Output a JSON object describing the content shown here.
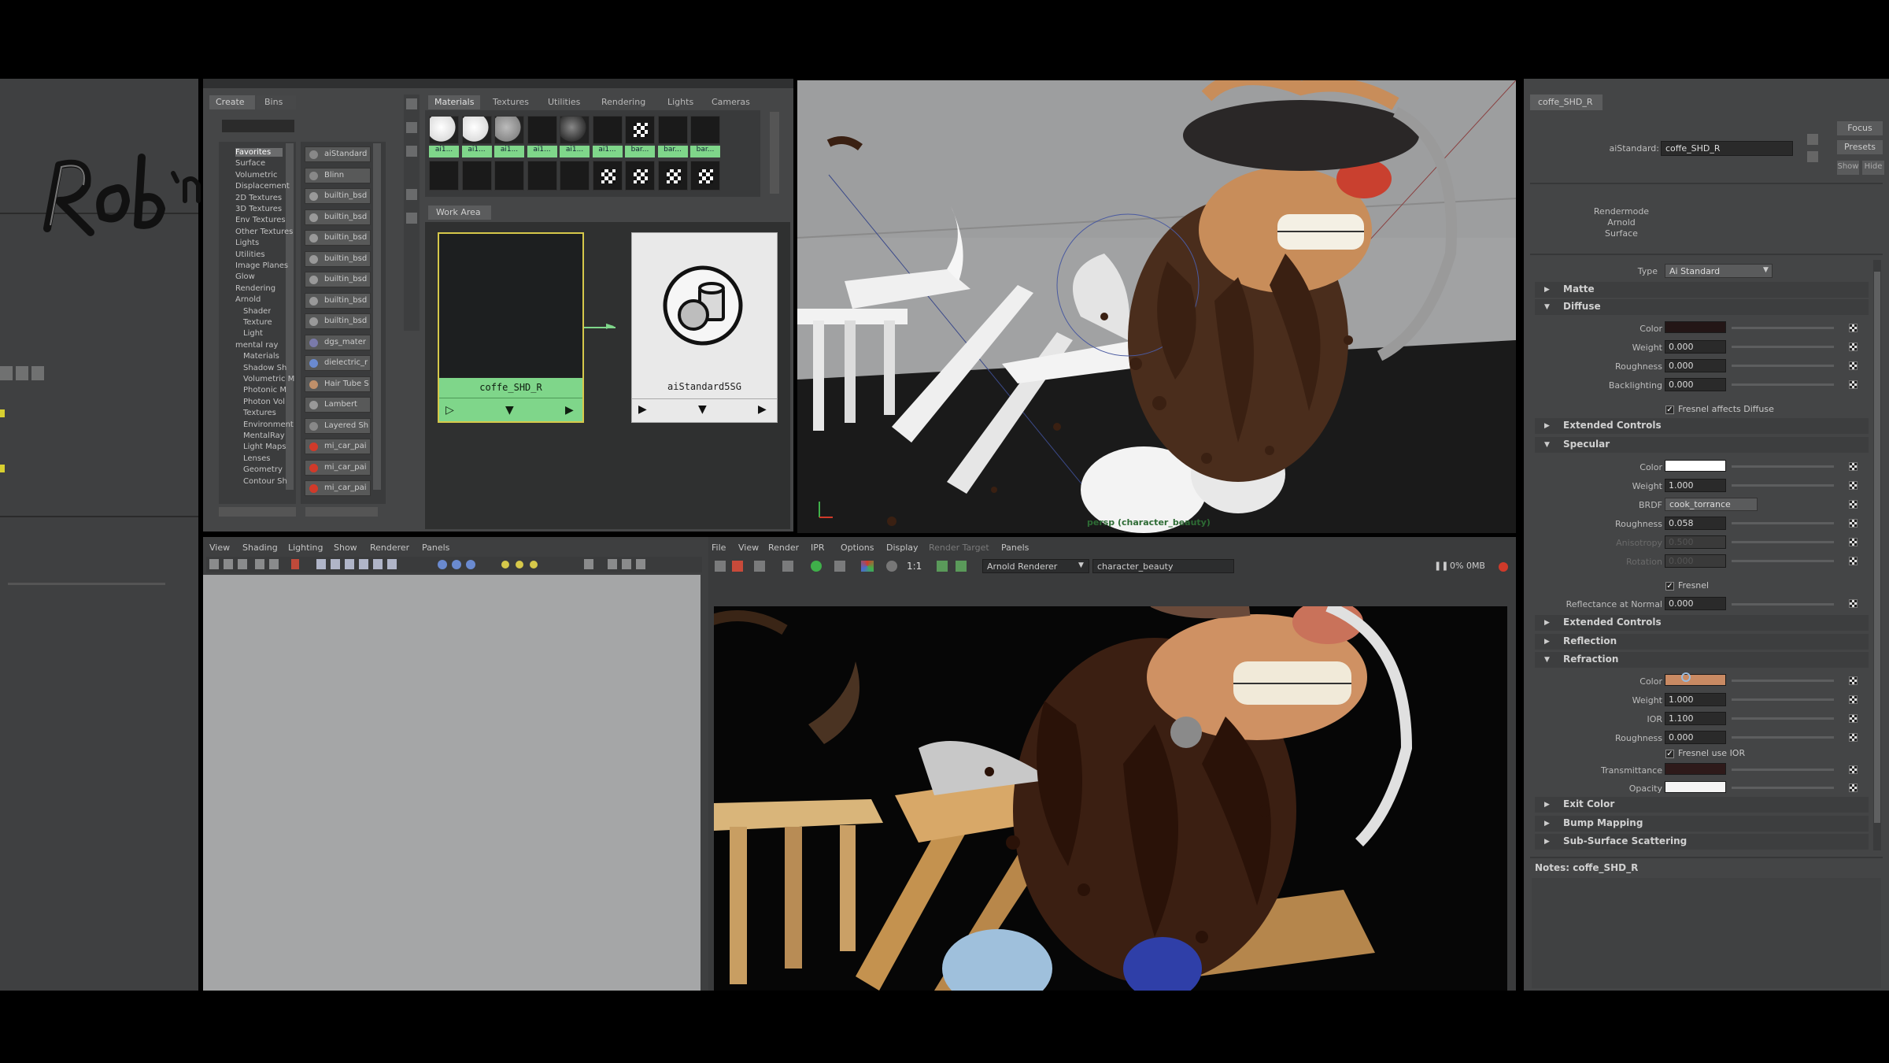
{
  "logo_text": "Rob'n'Ron",
  "hypershade": {
    "left_tabs": [
      "Create",
      "Bins"
    ],
    "tree": [
      "Favorites",
      "Surface",
      "Volumetric",
      "Displacement",
      "2D Textures",
      "3D Textures",
      "Env Textures",
      "Other Textures",
      "Lights",
      "Utilities",
      "Image Planes",
      "Glow",
      "Rendering",
      "Arnold",
      "Shader",
      "Texture",
      "Light",
      "mental ray",
      "Materials",
      "Shadow Sh",
      "Volumetric M",
      "Photonic M",
      "Photon Vol",
      "Textures",
      "Environment",
      "MentalRay",
      "Light Maps",
      "Lenses",
      "Geometry",
      "Contour Sh"
    ],
    "library": [
      "aiStandard",
      "Blinn",
      "builtin_bsd",
      "builtin_bsd",
      "builtin_bsd",
      "builtin_bsd",
      "builtin_bsd",
      "builtin_bsd",
      "builtin_bsd",
      "dgs_mater",
      "dielectric_r",
      "Hair Tube S",
      "Lambert",
      "Layered Sh",
      "mi_car_pai",
      "mi_car_pai",
      "mi_car_pai"
    ],
    "top_tabs": [
      "Materials",
      "Textures",
      "Utilities",
      "Rendering",
      "Lights",
      "Cameras"
    ],
    "swatch_labels": [
      "ai1...",
      "ai1...",
      "ai1...",
      "ai1...",
      "ai1...",
      "ai1...",
      "bar...",
      "bar...",
      "bar..."
    ],
    "work_area_tab": "Work Area",
    "node_left_label": "coffe_SHD_R",
    "node_right_label": "aiStandard5SG"
  },
  "viewport_top": {
    "camera_label": "persp (character_beauty)"
  },
  "lower_left_panel": {
    "menus": [
      "View",
      "Shading",
      "Lighting",
      "Show",
      "Renderer",
      "Panels"
    ]
  },
  "render_view": {
    "menus": [
      "File",
      "View",
      "Render",
      "IPR",
      "Options",
      "Display",
      "Render Target",
      "Panels"
    ],
    "ratio_label": "1:1",
    "renderer_select": "Arnold Renderer",
    "camera_select": "character_beauty",
    "status_text": "0% 0MB"
  },
  "attribute_editor": {
    "tab": "coffe_SHD_R",
    "top_buttons": [
      "Focus",
      "Presets",
      "Show",
      "Hide"
    ],
    "shader_label": "aiStandard:",
    "shader_name": "coffe_SHD_R",
    "swatch_caption": [
      "Rendermode",
      "Arnold",
      "Surface"
    ],
    "type_label": "Type",
    "type_value": "Ai Standard",
    "sections": {
      "matte": "Matte",
      "diffuse": "Diffuse",
      "extended1": "Extended Controls",
      "specular": "Specular",
      "extended2": "Extended Controls",
      "reflection": "Reflection",
      "refraction": "Refraction",
      "exit_color": "Exit Color",
      "bump": "Bump Mapping",
      "sss": "Sub-Surface Scattering"
    },
    "diffuse_rows": [
      {
        "label": "Color",
        "value": ""
      },
      {
        "label": "Weight",
        "value": "0.000"
      },
      {
        "label": "Roughness",
        "value": "0.000"
      },
      {
        "label": "Backlighting",
        "value": "0.000"
      }
    ],
    "fresnel_affects_diffuse": "Fresnel affects Diffuse",
    "specular_rows": [
      {
        "label": "Color",
        "value": ""
      },
      {
        "label": "Weight",
        "value": "1.000"
      },
      {
        "label": "BRDF",
        "value": "cook_torrance"
      },
      {
        "label": "Roughness",
        "value": "0.058"
      },
      {
        "label": "Anisotropy",
        "value": "0.500"
      },
      {
        "label": "Rotation",
        "value": "0.000"
      }
    ],
    "fresnel": "Fresnel",
    "reflectance_at_normal": {
      "label": "Reflectance at Normal",
      "value": "0.000"
    },
    "refraction_rows": [
      {
        "label": "Color",
        "value": ""
      },
      {
        "label": "Weight",
        "value": "1.000"
      },
      {
        "label": "IOR",
        "value": "1.100"
      },
      {
        "label": "Roughness",
        "value": "0.000"
      }
    ],
    "fresnel_use_ior": "Fresnel use IOR",
    "transmittance_label": "Transmittance",
    "opacity_label": "Opacity",
    "notes": "Notes:  coffe_SHD_R"
  },
  "colors": {
    "ui_bg": "#444546",
    "node_green": "#7fd68a",
    "selection_yellow": "#d6c84a",
    "render_red": "#d03a2a",
    "refraction_color": "#c98a63",
    "transmittance_color": "#2e1a1a",
    "diffuse_color": "#231616"
  }
}
